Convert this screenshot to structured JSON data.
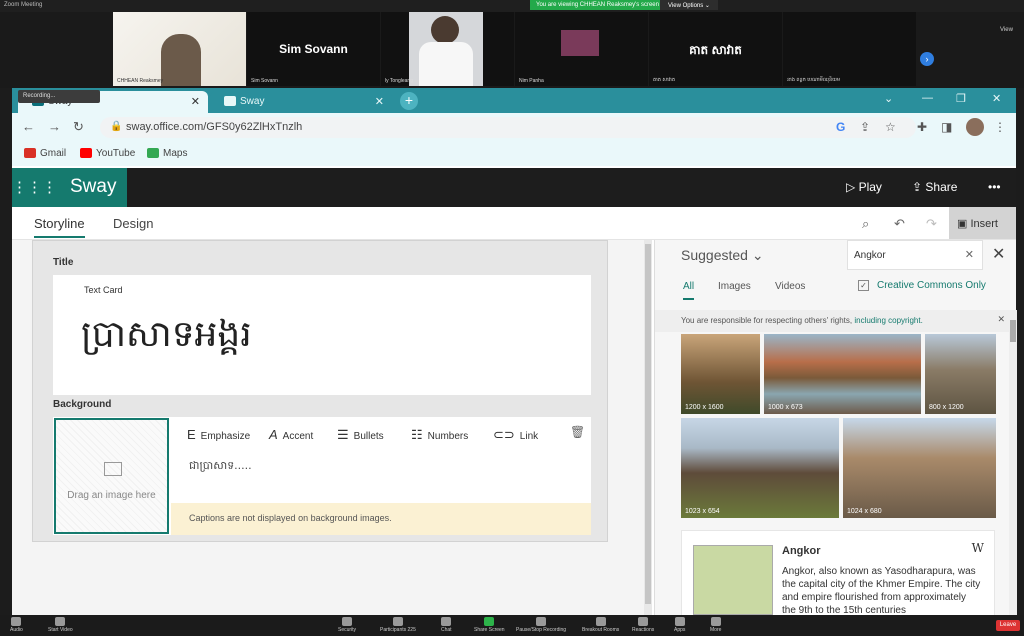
{
  "zoom": {
    "window_title": "Zoom Meeting",
    "share_banner": "You are viewing CHHEAN Reaksmey's screen",
    "view_options": "View Options ⌄",
    "view_label": "View",
    "participants": [
      {
        "label": "CHHEAN Reaksmey"
      },
      {
        "name": "Sim Sovann",
        "label": "Sim Sovann"
      },
      {
        "label": "ly Tongleang"
      },
      {
        "label": "Nim Panha"
      },
      {
        "name": "គាត សាវាត",
        "label": "គាត សាវាត"
      },
      {
        "label": "នាង ពន្លក បេណាមីឈុនិយម"
      }
    ]
  },
  "browser": {
    "recording_label": "Recording...",
    "tabs": [
      {
        "label": "Sway",
        "active": true
      },
      {
        "label": "Sway",
        "active": false
      }
    ],
    "url": "sway.office.com/GFS0y62ZlHxTnzlh",
    "bookmarks": [
      {
        "label": "Gmail",
        "color": "#d93025"
      },
      {
        "label": "YouTube",
        "color": "#ff0000"
      },
      {
        "label": "Maps",
        "color": "#34a853"
      }
    ]
  },
  "sway": {
    "brand": "Sway",
    "play_label": "Play",
    "share_label": "Share",
    "tabs": [
      {
        "label": "Storyline"
      },
      {
        "label": "Design"
      }
    ],
    "insert_label": "Insert",
    "title_section": "Title",
    "card_type": "Text Card",
    "card_title": "ប្រាសាទអង្គរ",
    "background_section": "Background",
    "drag_image": "Drag an image here",
    "format": {
      "emphasize": "Emphasize",
      "accent": "Accent",
      "bullets": "Bullets",
      "numbers": "Numbers",
      "link": "Link"
    },
    "caption_text": "ជាប្រាសាទ.....",
    "caption_note": "Captions are not displayed on background images.",
    "accent_color": "#157a6e"
  },
  "pane": {
    "suggested": "Suggested",
    "search_value": "Angkor",
    "filters": [
      {
        "label": "All"
      },
      {
        "label": "Images"
      },
      {
        "label": "Videos"
      }
    ],
    "creative_commons": "Creative Commons Only",
    "notice": "You are responsible for respecting others' rights,",
    "notice_link": "including copyright.",
    "images": [
      {
        "size": "1200 x 1600"
      },
      {
        "size": "1000 x 673"
      },
      {
        "size": "800 x 1200"
      },
      {
        "size": "1023 x 654"
      },
      {
        "size": "1024 x 680"
      }
    ],
    "wiki_title": "Angkor",
    "wiki_text": "Angkor, also known as Yasodharapura, was the capital city of the Khmer Empire. The city and empire flourished from approximately the 9th to the 15th centuries"
  },
  "zoombar": {
    "audio": "Audio",
    "start_video": "Start Video",
    "security": "Security",
    "participants": "Participants",
    "participant_count": "225",
    "chat": "Chat",
    "share_screen": "Share Screen",
    "pause_recording": "Pause/Stop Recording",
    "breakout": "Breakout Rooms",
    "reactions": "Reactions",
    "apps": "Apps",
    "more": "More",
    "leave": "Leave"
  }
}
